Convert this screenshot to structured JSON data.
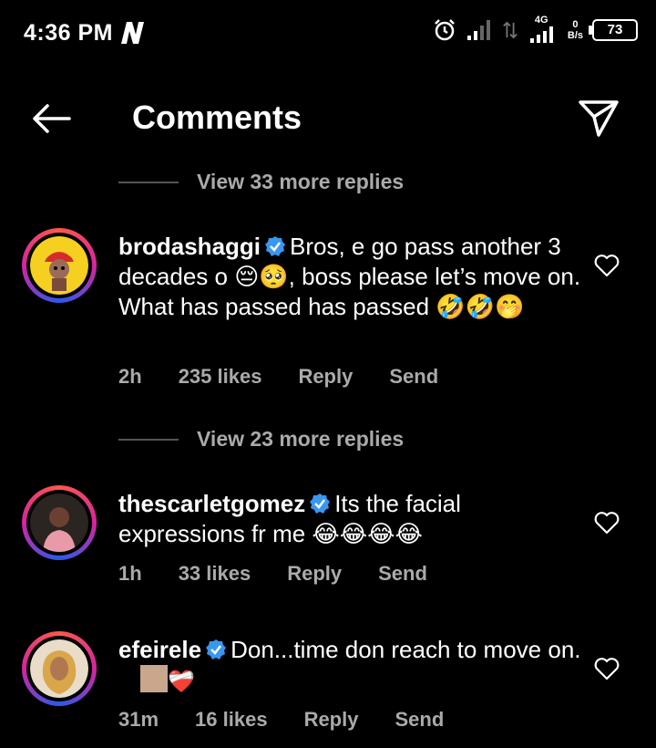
{
  "status": {
    "time": "4:36 PM",
    "network": "4G",
    "speed_top": "0",
    "speed_unit": "B/s",
    "battery": "73"
  },
  "header": {
    "title": "Comments"
  },
  "thread": {
    "view_more_1": "View 33 more replies",
    "view_more_2": "View 23 more replies"
  },
  "comments": [
    {
      "username": "brodashaggi",
      "text": "Bros, e go pass another 3 decades o 😔🥺, boss please let’s move on. What has passed has passed 🤣🤣🤭",
      "time": "2h",
      "likes": "235 likes",
      "reply": "Reply",
      "send": "Send"
    },
    {
      "username": "thescarletgomez",
      "text": "Its the facial expressions fr me 😂😂😂😂",
      "time": "1h",
      "likes": "33 likes",
      "reply": "Reply",
      "send": "Send"
    },
    {
      "username": "efeirele",
      "text": "Don...time don reach to move on.",
      "emoji_after": "❤️‍🩹",
      "time": "31m",
      "likes": "16 likes",
      "reply": "Reply",
      "send": "Send"
    }
  ],
  "colors": {
    "background": "#000000",
    "text": "#ffffff",
    "secondary_text": "#aaaaaa",
    "verified": "#3897f0"
  }
}
